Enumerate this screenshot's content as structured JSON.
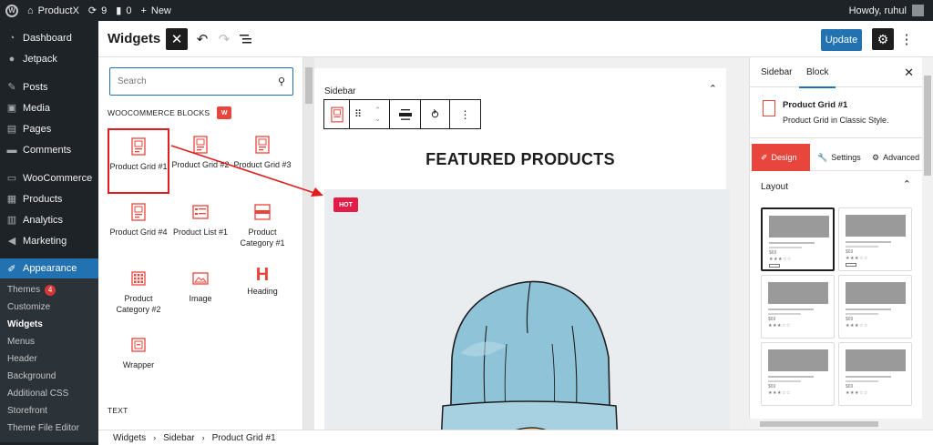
{
  "adminbar": {
    "site_name": "ProductX",
    "updates_count": "9",
    "comments_count": "0",
    "new_label": "New",
    "howdy": "Howdy, ruhul"
  },
  "menu": {
    "items": [
      {
        "label": "Dashboard",
        "icon": "dashboard-icon"
      },
      {
        "label": "Jetpack",
        "icon": "jetpack-icon"
      },
      {
        "label": "Posts",
        "icon": "pin-icon"
      },
      {
        "label": "Media",
        "icon": "media-icon"
      },
      {
        "label": "Pages",
        "icon": "pages-icon"
      },
      {
        "label": "Comments",
        "icon": "comments-icon"
      },
      {
        "label": "WooCommerce",
        "icon": "woocommerce-icon"
      },
      {
        "label": "Products",
        "icon": "products-icon"
      },
      {
        "label": "Analytics",
        "icon": "analytics-icon"
      },
      {
        "label": "Marketing",
        "icon": "marketing-icon"
      },
      {
        "label": "Appearance",
        "icon": "brush-icon"
      }
    ],
    "submenu": [
      {
        "label": "Themes",
        "badge": "4"
      },
      {
        "label": "Customize"
      },
      {
        "label": "Widgets"
      },
      {
        "label": "Menus"
      },
      {
        "label": "Header"
      },
      {
        "label": "Background"
      },
      {
        "label": "Additional CSS"
      },
      {
        "label": "Storefront"
      },
      {
        "label": "Theme File Editor"
      }
    ]
  },
  "header": {
    "title": "Widgets",
    "update_label": "Update"
  },
  "inserter": {
    "search_placeholder": "Search",
    "category_title": "WOOCOMMERCE BLOCKS",
    "blocks": [
      {
        "label": "Product Grid #1"
      },
      {
        "label": "Product Grid #2"
      },
      {
        "label": "Product Grid #3"
      },
      {
        "label": "Product Grid #4"
      },
      {
        "label": "Product List #1"
      },
      {
        "label": "Product Category #1"
      },
      {
        "label": "Product Category #2"
      },
      {
        "label": "Image"
      },
      {
        "label": "Heading"
      },
      {
        "label": "Wrapper"
      }
    ],
    "text_category": "TEXT"
  },
  "canvas": {
    "widget_area_title": "Sidebar",
    "heading": "FEATURED PRODUCTS",
    "badge": "HOT"
  },
  "settings": {
    "tabs": [
      "Sidebar",
      "Block"
    ],
    "block_title": "Product Grid #1",
    "block_desc": "Product Grid in Classic Style.",
    "panel_tabs": [
      "Design",
      "Settings",
      "Advanced"
    ],
    "layout_title": "Layout",
    "price_sample": "$69",
    "stars_sample": "★★★☆☆"
  },
  "breadcrumb": [
    "Widgets",
    "Sidebar",
    "Product Grid #1"
  ],
  "colors": {
    "accent": "#2271b1",
    "brand": "#e8453c",
    "annotation": "#e11d1d"
  }
}
